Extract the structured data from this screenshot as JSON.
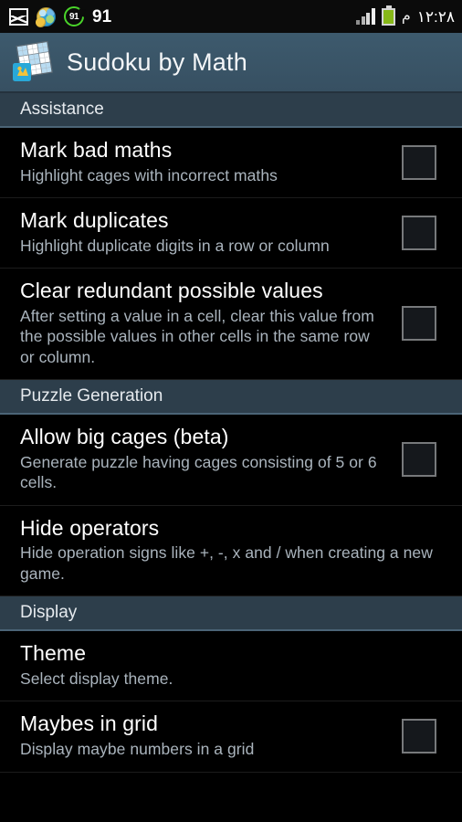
{
  "statusbar": {
    "left_icons": [
      {
        "name": "image-icon",
        "label": ""
      },
      {
        "name": "browser-globe-icon",
        "label": ""
      },
      {
        "name": "battery-percent-icon",
        "label": "91"
      }
    ],
    "notification_count": "91",
    "signal_icon": "signal-bars-icon",
    "battery_icon": "battery-icon",
    "am_pm": "م",
    "time": "١٢:٢٨"
  },
  "actionbar": {
    "app_icon": "sudoku-grid-icon",
    "title": "Sudoku by Math"
  },
  "sections": [
    {
      "header": "Assistance",
      "items": [
        {
          "title": "Mark bad maths",
          "summary": "Highlight cages with incorrect maths",
          "widget": "checkbox",
          "checked": false
        },
        {
          "title": "Mark duplicates",
          "summary": "Highlight duplicate digits in a row or column",
          "widget": "checkbox",
          "checked": false
        },
        {
          "title": "Clear redundant possible values",
          "summary": "After setting a value in a cell, clear this value from the possible values in other cells in the same row or column.",
          "widget": "checkbox",
          "checked": false
        }
      ]
    },
    {
      "header": "Puzzle Generation",
      "items": [
        {
          "title": "Allow big cages (beta)",
          "summary": "Generate puzzle having cages consisting of 5 or 6 cells.",
          "widget": "checkbox",
          "checked": false
        },
        {
          "title": "Hide operators",
          "summary": "Hide operation signs like +, -, x and / when creating a new game.",
          "widget": "none",
          "checked": false
        }
      ]
    },
    {
      "header": "Display",
      "items": [
        {
          "title": "Theme",
          "summary": "Select display theme.",
          "widget": "none",
          "checked": false
        },
        {
          "title": "Maybes in grid",
          "summary": "Display maybe numbers in a grid",
          "widget": "checkbox",
          "checked": false
        }
      ]
    }
  ],
  "colors": {
    "actionbar": "#3a5466",
    "section_header": "#2d3e4b",
    "section_accent": "#4b6476",
    "background": "#000000",
    "title_text": "#ffffff",
    "summary_text": "#aab4bd",
    "battery_green": "#87b818"
  }
}
